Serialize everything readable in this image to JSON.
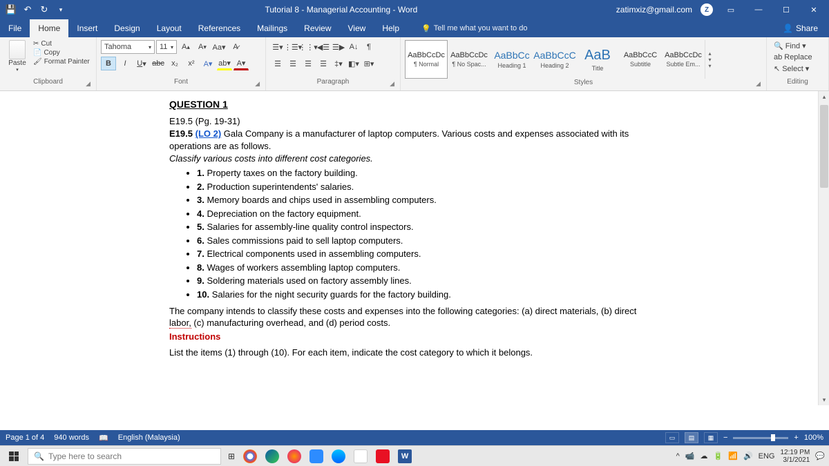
{
  "titlebar": {
    "title": "Tutorial 8 - Managerial Accounting  -  Word",
    "user_email": "zatimxiz@gmail.com",
    "user_initial": "Z"
  },
  "menu": {
    "file": "File",
    "home": "Home",
    "insert": "Insert",
    "design": "Design",
    "layout": "Layout",
    "references": "References",
    "mailings": "Mailings",
    "review": "Review",
    "view": "View",
    "help": "Help",
    "tellme": "Tell me what you want to do",
    "share": "Share"
  },
  "ribbon": {
    "clipboard": {
      "label": "Clipboard",
      "paste": "Paste",
      "cut": "Cut",
      "copy": "Copy",
      "format_painter": "Format Painter"
    },
    "font": {
      "label": "Font",
      "name": "Tahoma",
      "size": "11"
    },
    "paragraph": {
      "label": "Paragraph"
    },
    "styles": {
      "label": "Styles",
      "items": [
        {
          "preview": "AaBbCcDc",
          "name": "¶ Normal"
        },
        {
          "preview": "AaBbCcDc",
          "name": "¶ No Spac..."
        },
        {
          "preview": "AaBbCc",
          "name": "Heading 1"
        },
        {
          "preview": "AaBbCcC",
          "name": "Heading 2"
        },
        {
          "preview": "AaB",
          "name": "Title"
        },
        {
          "preview": "AaBbCcC",
          "name": "Subtitle"
        },
        {
          "preview": "AaBbCcDc",
          "name": "Subtle Em..."
        }
      ]
    },
    "editing": {
      "label": "Editing",
      "find": "Find",
      "replace": "Replace",
      "select": "Select"
    }
  },
  "doc": {
    "q_title": "QUESTION 1",
    "ref": "E19.5 (Pg. 19-31)",
    "exercise_no": "E19.5",
    "lo": "(LO 2)",
    "intro": " Gala Company is a manufacturer of laptop computers. Various costs and expenses associated with its operations are as follows.",
    "italic_intro": "Classify various costs into different cost categories.",
    "items": [
      "Property taxes on the factory building.",
      "Production superintendents' salaries.",
      "Memory boards and chips used in assembling computers.",
      "Depreciation on the factory equipment.",
      "Salaries for assembly-line quality control inspectors.",
      "Sales commissions paid to sell laptop computers.",
      "Electrical components used in assembling computers.",
      "Wages of workers assembling laptop computers.",
      "Soldering materials used on factory assembly lines.",
      "Salaries for the night security guards for the factory building."
    ],
    "outro1a": "The company intends to classify these costs and expenses into the following categories: (a) direct materials, (b) direct ",
    "outro1_labor": "labor,",
    "outro1b": " (c) manufacturing overhead, and (d) period costs.",
    "instructions": "Instructions",
    "outro2": "List the items (1) through (10). For each item, indicate the cost category to which it belongs."
  },
  "status": {
    "page": "Page 1 of 4",
    "words": "940 words",
    "lang": "English (Malaysia)",
    "zoom": "100%"
  },
  "taskbar": {
    "search_placeholder": "Type here to search",
    "lang": "ENG",
    "time": "12:19 PM",
    "date": "3/1/2021"
  }
}
